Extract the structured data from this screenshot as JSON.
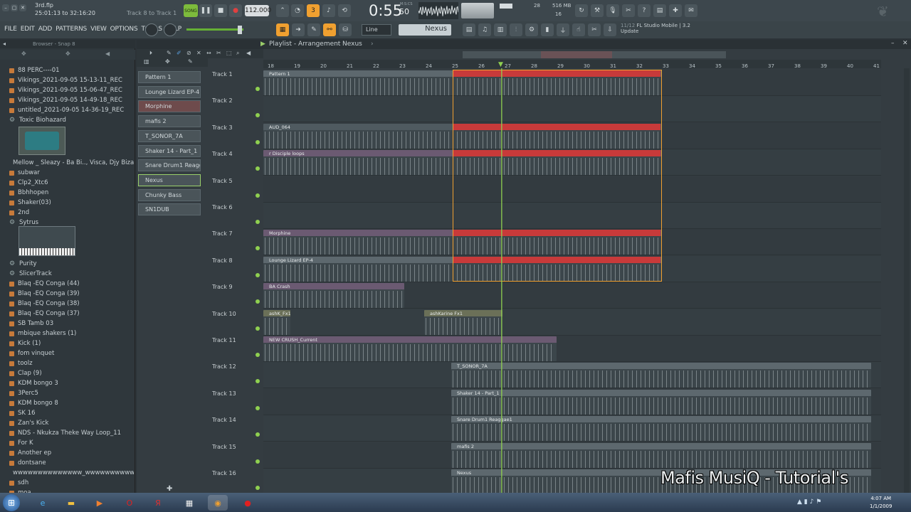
{
  "titlebar": {
    "file_name": "3rd.flp",
    "time_range": "25:01:13 to 32:16:20",
    "hint": "Track 8 to Track 1",
    "song_mode": "SONG",
    "tempo": "112.000",
    "clock": "0:55",
    "clock_sub": "50",
    "clock_label": "M:S:CS",
    "cpu": "28",
    "ram": "516 MB",
    "poly": "16"
  },
  "menu": [
    "FILE",
    "EDIT",
    "ADD",
    "PATTERNS",
    "VIEW",
    "OPTIONS",
    "TOOLS",
    "HELP"
  ],
  "toolbar": {
    "snap_mode": "Line",
    "pattern_name": "Nexus",
    "news_date": "11/12",
    "news_text": "FL Studio Mobile | 3.2",
    "news_sub": "Update"
  },
  "browser": {
    "title": "Browser - Snap 8",
    "items": [
      {
        "label": "88 PERC----01",
        "kind": "folder"
      },
      {
        "label": "Vikings_2021-09-05 15-13-11_REC",
        "kind": "folder"
      },
      {
        "label": "Vikings_2021-09-05 15-06-47_REC",
        "kind": "folder"
      },
      {
        "label": "Vikings_2021-09-05 14-49-18_REC",
        "kind": "folder"
      },
      {
        "label": "untitled_2021-09-05 14-36-19_REC",
        "kind": "folder"
      },
      {
        "label": "Toxic Biohazard",
        "kind": "plugin"
      },
      {
        "label": "Mellow _ Sleazy - Ba Bi.., Visca, Djy Biza (320K)",
        "kind": "folder"
      },
      {
        "label": "subwar",
        "kind": "folder"
      },
      {
        "label": "Clp2_Xtc6",
        "kind": "folder"
      },
      {
        "label": "Bbhhopen",
        "kind": "folder"
      },
      {
        "label": "Shaker(03)",
        "kind": "folder"
      },
      {
        "label": "2nd",
        "kind": "folder"
      },
      {
        "label": "Sytrus",
        "kind": "plugin"
      },
      {
        "label": "Purity",
        "kind": "plugin"
      },
      {
        "label": "SlicerTrack",
        "kind": "plugin"
      },
      {
        "label": "Blaq -EQ Conga (44)",
        "kind": "folder"
      },
      {
        "label": "Blaq -EQ Conga (39)",
        "kind": "folder"
      },
      {
        "label": "Blaq -EQ Conga (38)",
        "kind": "folder"
      },
      {
        "label": "Blaq -EQ Conga (37)",
        "kind": "folder"
      },
      {
        "label": "SB Tamb 03",
        "kind": "folder"
      },
      {
        "label": "mbique shakers (1)",
        "kind": "folder"
      },
      {
        "label": "Kick (1)",
        "kind": "folder"
      },
      {
        "label": "fom vinquet",
        "kind": "folder"
      },
      {
        "label": "toolz",
        "kind": "folder"
      },
      {
        "label": "Clap (9)",
        "kind": "folder"
      },
      {
        "label": "KDM bongo 3",
        "kind": "folder"
      },
      {
        "label": "3Perc5",
        "kind": "folder"
      },
      {
        "label": "KDM bongo 8",
        "kind": "folder"
      },
      {
        "label": "SK 16",
        "kind": "folder"
      },
      {
        "label": "Zan's Kick",
        "kind": "folder"
      },
      {
        "label": "NDS - Nkukza Theke Way Loop_11",
        "kind": "folder"
      },
      {
        "label": "For K",
        "kind": "folder"
      },
      {
        "label": "Another ep",
        "kind": "folder"
      },
      {
        "label": "dontsane",
        "kind": "folder"
      },
      {
        "label": "wwwwwwwwwwwwww_wwwwwwwwwwwwwwwwww",
        "kind": "folder"
      },
      {
        "label": "sdh",
        "kind": "folder"
      },
      {
        "label": "moa",
        "kind": "folder"
      }
    ]
  },
  "playlist": {
    "title": "Playlist - Arrangement",
    "pattern": "Nexus",
    "ruler": [
      "18",
      "19",
      "20",
      "21",
      "22",
      "23",
      "24",
      "25",
      "26",
      "27",
      "28",
      "29",
      "30",
      "31",
      "32",
      "33",
      "34",
      "35",
      "36",
      "37",
      "38",
      "39",
      "40",
      "41"
    ],
    "patterns": [
      {
        "label": "Pattern 1",
        "style": "normal"
      },
      {
        "label": "Lounge Lizard EP-4",
        "style": "normal"
      },
      {
        "label": "Morphine",
        "style": "red"
      },
      {
        "label": "mafis 2",
        "style": "normal"
      },
      {
        "label": "T_SONOR_7A",
        "style": "normal"
      },
      {
        "label": "Shaker 14 - Part_1",
        "style": "normal"
      },
      {
        "label": "Snare Drum1  Reaggae1",
        "style": "normal"
      },
      {
        "label": "Nexus",
        "style": "green"
      },
      {
        "label": "Chunky Bass",
        "style": "normal"
      },
      {
        "label": "SN1DUB",
        "style": "normal"
      }
    ],
    "tracks": [
      "Track 1",
      "Track 2",
      "Track 3",
      "Track 4",
      "Track 5",
      "Track 6",
      "Track 7",
      "Track 8",
      "Track 9",
      "Track 10",
      "Track 11",
      "Track 12",
      "Track 13",
      "Track 14",
      "Track 15",
      "Track 16"
    ],
    "clips": [
      {
        "track": 0,
        "label": "Pattern 1",
        "color": "#5d686e"
      },
      {
        "track": 2,
        "label": "AUD_064",
        "color": "#4f5a60"
      },
      {
        "track": 3,
        "label": "r Disciple loops",
        "color": "#6b5a72"
      },
      {
        "track": 6,
        "label": "Morphine",
        "color": "#6b5a72"
      },
      {
        "track": 7,
        "label": "Lounge Lizard EP-4",
        "color": "#5d686e"
      },
      {
        "track": 8,
        "label": "BA Crash",
        "color": "#6b5a72"
      },
      {
        "track": 9,
        "label": "ashK_Fx1",
        "color": "#6b7058"
      },
      {
        "track": 9,
        "label": "ashKarine Fx1",
        "color": "#6b7058"
      },
      {
        "track": 10,
        "label": "NEW CRUSH_Current",
        "color": "#6b5a72"
      },
      {
        "track": 11,
        "label": "T_SONOR_7A",
        "color": "#5d686e"
      },
      {
        "track": 12,
        "label": "Shaker 14 - Part_1",
        "color": "#5d686e"
      },
      {
        "track": 13,
        "label": "Snare Drum1  Reaggae1",
        "color": "#5d686e"
      },
      {
        "track": 14,
        "label": "mafis 2",
        "color": "#5d686e"
      },
      {
        "track": 15,
        "label": "Nexus",
        "color": "#5d686e"
      }
    ]
  },
  "taskbar": {
    "time": "4:07 AM",
    "date": "1/1/2009"
  },
  "watermark": "Mafis MusiQ - Tutorial's",
  "colors": {
    "accent_orange": "#f0a030",
    "selection_red": "#c83a3a",
    "playhead_green": "#8fd050"
  }
}
